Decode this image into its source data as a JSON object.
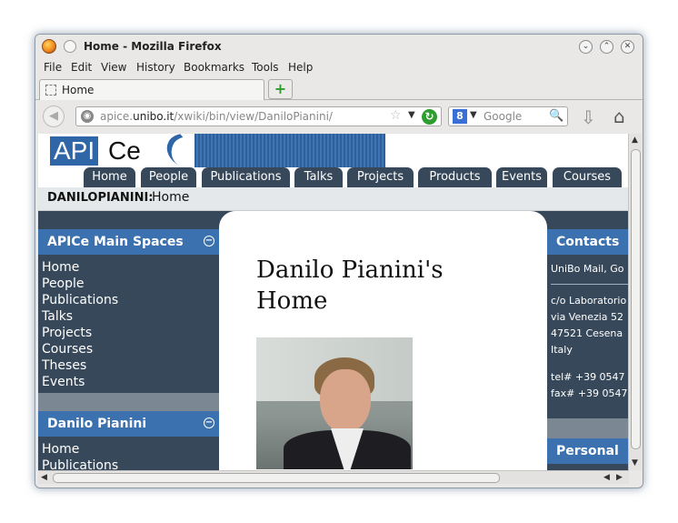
{
  "window": {
    "title": "Home - Mozilla Firefox"
  },
  "menu": [
    "File",
    "Edit",
    "View",
    "History",
    "Bookmarks",
    "Tools",
    "Help"
  ],
  "tab": {
    "label": "Home"
  },
  "url": {
    "prefix": "apice.",
    "host": "unibo.it",
    "path": "/xwiki/bin/view/DaniloPianini/"
  },
  "search": {
    "placeholder": "Google"
  },
  "site": {
    "logo_left": "API",
    "logo_right": "Ce",
    "nav": [
      "Home",
      "People",
      "Publications",
      "Talks",
      "Projects",
      "Products",
      "Events",
      "Courses"
    ],
    "breadcrumb_user": "DANILOPIANINI:",
    "breadcrumb_page": "Home"
  },
  "left": {
    "spaces_title": "APICe Main Spaces",
    "spaces_links": [
      "Home",
      "People",
      "Publications",
      "Talks",
      "Projects",
      "Courses",
      "Theses",
      "Events"
    ],
    "user_title": "Danilo Pianini",
    "user_links": [
      "Home",
      "Publications"
    ]
  },
  "main": {
    "title": "Danilo Pianini's Home"
  },
  "right": {
    "contacts_title": "Contacts",
    "mail": "UniBo Mail, Go",
    "address": [
      "c/o Laboratorio",
      "via Venezia 52",
      "47521 Cesena",
      "Italy"
    ],
    "phones": [
      "tel# +39 0547",
      "fax# +39 0547"
    ],
    "personal_title": "Personal"
  }
}
